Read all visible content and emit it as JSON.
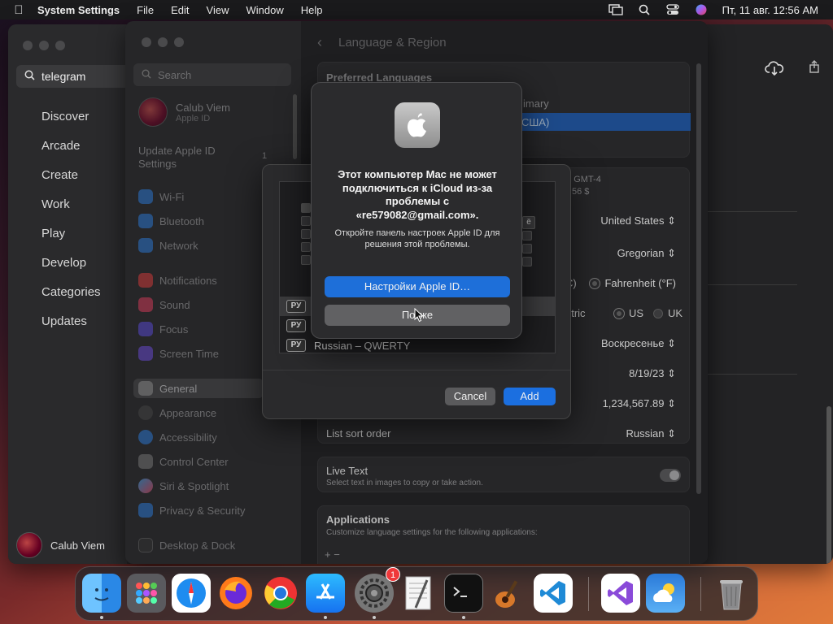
{
  "menubar": {
    "app_name": "System Settings",
    "menus": [
      "File",
      "Edit",
      "View",
      "Window",
      "Help"
    ],
    "clock": "Пт, 11 авг.  12:56 AM"
  },
  "appstore": {
    "search_value": "telegram",
    "nav": [
      "Discover",
      "Arcade",
      "Create",
      "Work",
      "Play",
      "Develop",
      "Categories",
      "Updates"
    ],
    "user_name": "Calub Viem"
  },
  "settings": {
    "search_placeholder": "Search",
    "profile_name": "Calub Viem",
    "profile_sub": "Apple ID",
    "update_text": "Update Apple ID Settings",
    "update_badge": "1",
    "sidebar": {
      "wifi": "Wi-Fi",
      "bluetooth": "Bluetooth",
      "network": "Network",
      "notifications": "Notifications",
      "sound": "Sound",
      "focus": "Focus",
      "screen_time": "Screen Time",
      "general": "General",
      "appearance": "Appearance",
      "accessibility": "Accessibility",
      "control_center": "Control Center",
      "siri": "Siri & Spotlight",
      "privacy": "Privacy & Security",
      "desktop": "Desktop & Dock"
    },
    "title": "Language & Region",
    "preferred_languages": "Preferred Languages",
    "lang_primary_fragment": "imary",
    "lang_selected_fragment": "США)",
    "region_fragment": "M GMT-4",
    "region_fragment2": "56 $",
    "region_value": "United States",
    "calendar_value": "Gregorian",
    "temp_c_fragment": "C)",
    "temp_f": "Fahrenheit (°F)",
    "measure_fragment": "etric",
    "measure_us": "US",
    "measure_uk": "UK",
    "first_day": "Воскресенье",
    "date_format": "8/19/23",
    "number_format": "1,234,567.89",
    "list_sort_label": "List sort order",
    "list_sort_value": "Russian",
    "live_text_label": "Live Text",
    "live_text_sub": "Select text in images to copy or take action.",
    "applications_label": "Applications",
    "applications_sub": "Customize language settings for the following applications:",
    "add_remove": "+   −"
  },
  "sheet": {
    "sources": [
      {
        "badge": "РУ",
        "label": ""
      },
      {
        "badge": "РУ",
        "label": ""
      },
      {
        "badge": "РУ",
        "label": "Russian – QWERTY"
      }
    ],
    "cancel": "Cancel",
    "add": "Add",
    "preview_key": "ё"
  },
  "alert": {
    "title": "Этот компьютер Mac не может подключиться к iCloud из-за проблемы с «re579082@gmail.com».",
    "message": "Откройте панель настроек Apple ID для решения этой проблемы.",
    "primary_button": "Настройки Apple ID…",
    "secondary_button": "Позже"
  },
  "dock": {
    "settings_badge": "1"
  }
}
